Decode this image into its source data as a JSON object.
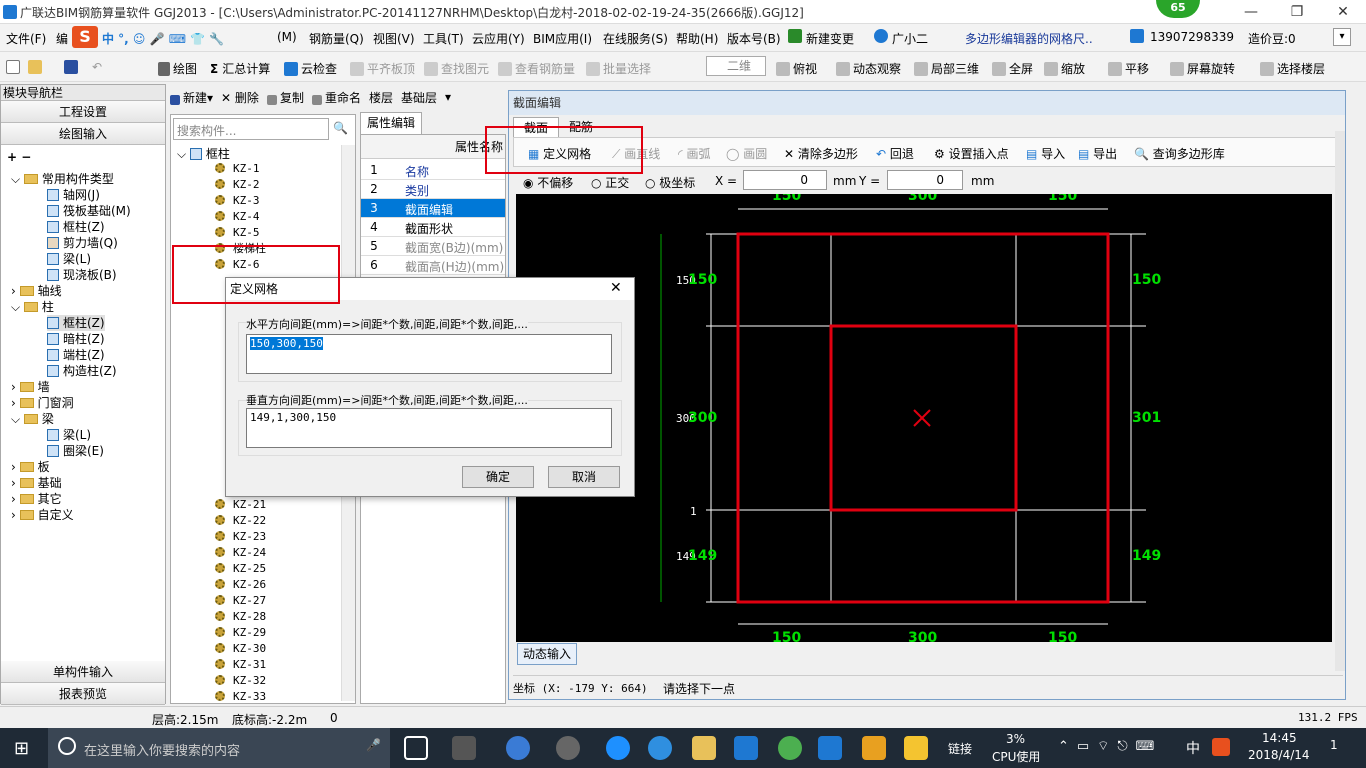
{
  "title": {
    "text": "广联达BIM钢筋算量软件 GGJ2013 - [C:\\Users\\Administrator.PC-20141127NRHM\\Desktop\\白龙村-2018-02-02-19-24-35(2666版).GGJ12]",
    "badge": "65",
    "minimize": "—",
    "restore": "❐",
    "close": "✕"
  },
  "menu": {
    "file": "文件(F)",
    "edit": "编",
    "ime": "中 °, ☺ 🎤 ⌨ 👕 🔧",
    "m": "(M)",
    "rebar": "钢筋量(Q)",
    "view": "视图(V)",
    "tool": "工具(T)",
    "cloud": "云应用(Y)",
    "bim": "BIM应用(I)",
    "online": "在线服务(S)",
    "help": "帮助(H)",
    "version": "版本号(B)",
    "newchange": "新建变更",
    "assistant": "广小二",
    "news": "多边形编辑器的网格尺..",
    "phone": "13907298339",
    "price": "造价豆:0"
  },
  "toolbar": {
    "draw": "绘图",
    "sum": "汇总计算",
    "cloudcheck": "云检查",
    "flush": "平齐板顶",
    "findelem": "查找图元",
    "viewrebar": "查看钢筋量",
    "batch": "批量选择",
    "mode2d": "二维",
    "topview": "俯视",
    "dynamic": "动态观察",
    "local3d": "局部三维",
    "fullscreen": "全屏",
    "zoom": "缩放",
    "pan": "平移",
    "rotate": "屏幕旋转",
    "selfloor": "选择楼层"
  },
  "nav": {
    "header": "模块导航栏",
    "project_settings": "工程设置",
    "drawing_input": "绘图输入",
    "single_input": "单构件输入",
    "report": "报表预览",
    "tree": {
      "common": "常用构件类型",
      "axis_grid": "轴网(J)",
      "raft": "筏板基础(M)",
      "frame_col": "框柱(Z)",
      "shear_wall": "剪力墙(Q)",
      "beam": "梁(L)",
      "slab": "现浇板(B)",
      "axis": "轴线",
      "column": "柱",
      "col_frame": "框柱(Z)",
      "col_hidden": "暗柱(Z)",
      "col_end": "端柱(Z)",
      "col_struct": "构造柱(Z)",
      "wall": "墙",
      "door": "门窗洞",
      "beam_group": "梁",
      "beam_l": "梁(L)",
      "ring_beam": "圈梁(E)",
      "plate": "板",
      "foundation": "基础",
      "other": "其它",
      "custom": "自定义"
    }
  },
  "list": {
    "new": "新建",
    "delete": "删除",
    "copy": "复制",
    "rename": "重命名",
    "floor_label": "楼层",
    "floor_value": "基础层",
    "search_placeholder": "搜索构件...",
    "root": "框柱",
    "items": [
      "KZ-1",
      "KZ-2",
      "KZ-3",
      "KZ-4",
      "KZ-5",
      "楼梯柱",
      "KZ-6"
    ],
    "items2": [
      "KZ-21",
      "KZ-22",
      "KZ-23",
      "KZ-24",
      "KZ-25",
      "KZ-26",
      "KZ-27",
      "KZ-28",
      "KZ-29",
      "KZ-30",
      "KZ-31",
      "KZ-32",
      "KZ-33"
    ]
  },
  "props": {
    "tab": "属性编辑",
    "header": "属性名称",
    "rows": [
      {
        "n": "1",
        "v": "名称"
      },
      {
        "n": "2",
        "v": "类别"
      },
      {
        "n": "3",
        "v": "截面编辑"
      },
      {
        "n": "4",
        "v": "截面形状"
      },
      {
        "n": "5",
        "v": "截面宽(B边)(mm)"
      },
      {
        "n": "6",
        "v": "截面高(H边)(mm)"
      }
    ]
  },
  "section": {
    "title": "截面编辑",
    "tab1": "截面",
    "tab2": "配筋",
    "define_grid": "定义网格",
    "line": "画直线",
    "arc": "画弧",
    "circle": "画圆",
    "clear": "清除多边形",
    "undo": "回退",
    "insert": "设置插入点",
    "import": "导入",
    "export": "导出",
    "query": "查询多边形库",
    "no_offset": "不偏移",
    "ortho": "正交",
    "polar": "极坐标",
    "x_label": "X =",
    "y_label": "Y =",
    "x_value": "0",
    "y_value": "0",
    "unit": "mm",
    "dynamic_input": "动态输入",
    "coord": "坐标 (X: -179 Y: 664)",
    "prompt": "请选择下一点"
  },
  "drawing": {
    "top_dims": [
      "150",
      "300",
      "150"
    ],
    "bottom_dims": [
      "150",
      "300",
      "150"
    ],
    "left_dims": [
      "150",
      "300",
      "1",
      "149"
    ],
    "left_green": [
      "150",
      "300",
      "149"
    ],
    "right_dims": [
      "150",
      "301",
      "149"
    ]
  },
  "dialog": {
    "title": "定义网格",
    "close": "✕",
    "h_label": "水平方向间距(mm)=>间距*个数,间距,间距*个数,间距,...",
    "h_value": "150,300,150",
    "v_label": "垂直方向间距(mm)=>间距*个数,间距,间距*个数,间距,...",
    "v_value": "149,1,300,150",
    "ok": "确定",
    "cancel": "取消"
  },
  "status": {
    "floor_height": "层高:2.15m",
    "base_height": "底标高:-2.2m",
    "zero": "0",
    "fps": "131.2 FPS"
  },
  "taskbar": {
    "search": "在这里输入你要搜索的内容",
    "link": "链接",
    "cpu_pct": "3%",
    "cpu_label": "CPU使用",
    "lang": "中",
    "time": "14:45",
    "date": "2018/4/14",
    "notif": "1"
  },
  "colors": {
    "canvas_bg": "#000000",
    "dimension_green": "#00e000",
    "highlight_red": "#e00010",
    "selected_blue": "#0078d7"
  }
}
